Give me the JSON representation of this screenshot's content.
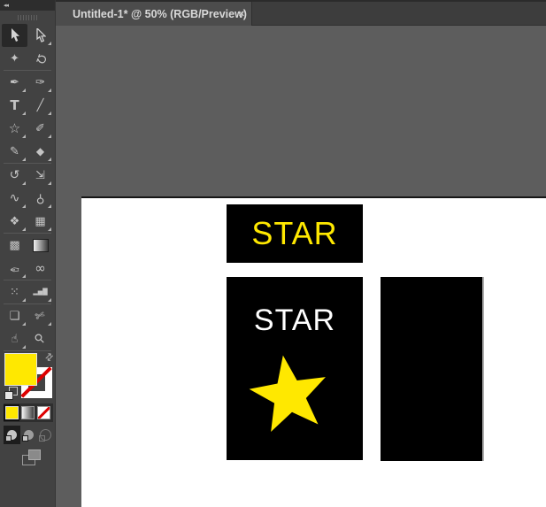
{
  "tab": {
    "title": "Untitled-1* @ 50% (RGB/Preview)",
    "close_icon": "✕"
  },
  "toolbar": {
    "collapse_icon": "◂◂",
    "tools": [
      {
        "name": "selection-tool",
        "glyph": "",
        "selected": true
      },
      {
        "name": "direct-selection-tool",
        "glyph": ""
      },
      {
        "name": "magic-wand-tool",
        "glyph": "✦"
      },
      {
        "name": "lasso-tool",
        "glyph": "Ω"
      },
      {
        "name": "pen-tool",
        "glyph": "✒"
      },
      {
        "name": "curvature-tool",
        "glyph": "✑"
      },
      {
        "name": "type-tool",
        "glyph": "T"
      },
      {
        "name": "line-segment-tool",
        "glyph": "╱"
      },
      {
        "name": "star-shape-tool",
        "glyph": "☆"
      },
      {
        "name": "paintbrush-tool",
        "glyph": "✐"
      },
      {
        "name": "shaper-tool",
        "glyph": "✎"
      },
      {
        "name": "eraser-tool",
        "glyph": "◆"
      },
      {
        "name": "rotate-tool",
        "glyph": "↺"
      },
      {
        "name": "scale-tool",
        "glyph": "⇲"
      },
      {
        "name": "width-tool",
        "glyph": "∿"
      },
      {
        "name": "puppet-warp-tool",
        "glyph": "⚲"
      },
      {
        "name": "shape-builder-tool",
        "glyph": "❖"
      },
      {
        "name": "perspective-grid-tool",
        "glyph": "▦"
      },
      {
        "name": "mesh-tool",
        "glyph": "▩"
      },
      {
        "name": "gradient-tool",
        "glyph": ""
      },
      {
        "name": "eyedropper-tool",
        "glyph": "✑"
      },
      {
        "name": "blend-tool",
        "glyph": "∞"
      },
      {
        "name": "symbol-sprayer-tool",
        "glyph": "⁙"
      },
      {
        "name": "column-graph-tool",
        "glyph": "▂▅█"
      },
      {
        "name": "artboard-tool",
        "glyph": "❏"
      },
      {
        "name": "slice-tool",
        "glyph": "✄"
      },
      {
        "name": "hand-tool",
        "glyph": "☝"
      },
      {
        "name": "zoom-tool",
        "glyph": "⚲"
      }
    ],
    "swap_icon": "⇄",
    "fill": {
      "type": "color",
      "value": "#ffe800"
    },
    "stroke": {
      "type": "none"
    },
    "color_buttons": [
      {
        "name": "color-button",
        "selected": true
      },
      {
        "name": "gradient-button",
        "selected": false
      },
      {
        "name": "none-button",
        "selected": false
      }
    ],
    "drawing_modes": [
      {
        "name": "draw-normal-mode",
        "selected": true
      },
      {
        "name": "draw-behind-mode",
        "selected": false
      },
      {
        "name": "draw-inside-mode",
        "selected": false
      }
    ]
  },
  "artboard": {
    "banner": {
      "label": "STAR"
    },
    "poster": {
      "label": "STAR"
    }
  },
  "colors": {
    "accent_yellow": "#ffe800",
    "stroke_none_red": "#dd0000",
    "canvas_gray": "#5d5d5d",
    "panel_gray": "#424242",
    "tabbar_gray": "#3d3d3d",
    "tab_gray": "#4c4c4c",
    "artboard_white": "#ffffff",
    "shape_black": "#000000"
  }
}
